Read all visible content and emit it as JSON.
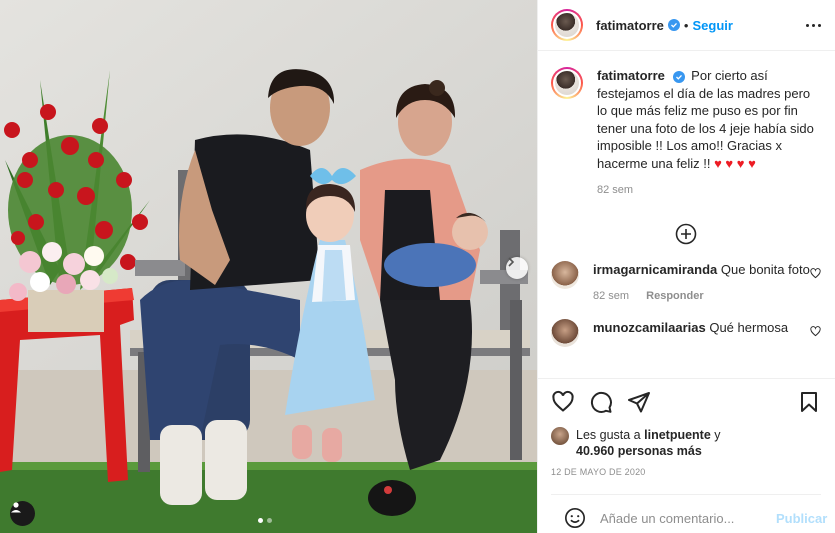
{
  "post": {
    "username": "fatimatorre",
    "follow_label": "Seguir",
    "separator": "•",
    "verified": true
  },
  "caption": {
    "username": "fatimatorre",
    "text": "Por cierto así festejamos el día de las madres pero lo que más feliz me puso es por fin tener una foto de los 4 jeje había sido imposible !! Los amo!! Gracias x hacerme una feliz !!",
    "hearts": "♥ ♥ ♥ ♥",
    "time": "82 sem"
  },
  "comments": [
    {
      "username": "irmagarnicamiranda",
      "text": "Que bonita foto",
      "time": "82 sem",
      "reply_label": "Responder"
    },
    {
      "username": "munozcamilaarias",
      "text": "Qué hermosa"
    }
  ],
  "likes": {
    "prefix": "Les gusta a",
    "user": "linetpuente",
    "conj": "y",
    "count": "40.960 personas más"
  },
  "date": "12 DE MAYO DE 2020",
  "comment_input": {
    "placeholder": "Añade un comentario...",
    "publish_label": "Publicar"
  },
  "carousel": {
    "index": 0,
    "total": 2
  },
  "colors": {
    "accent": "#0095f6",
    "verified": "#3897f0",
    "heart": "#ed1c24",
    "muted": "#8e8e8e",
    "publish_disabled": "#b2dffc"
  },
  "icons": [
    "verified-icon",
    "more-options-icon",
    "next-arrow-icon",
    "tag-people-icon",
    "add-comments-icon",
    "like-icon",
    "comment-icon",
    "share-icon",
    "save-icon",
    "emoji-icon"
  ]
}
